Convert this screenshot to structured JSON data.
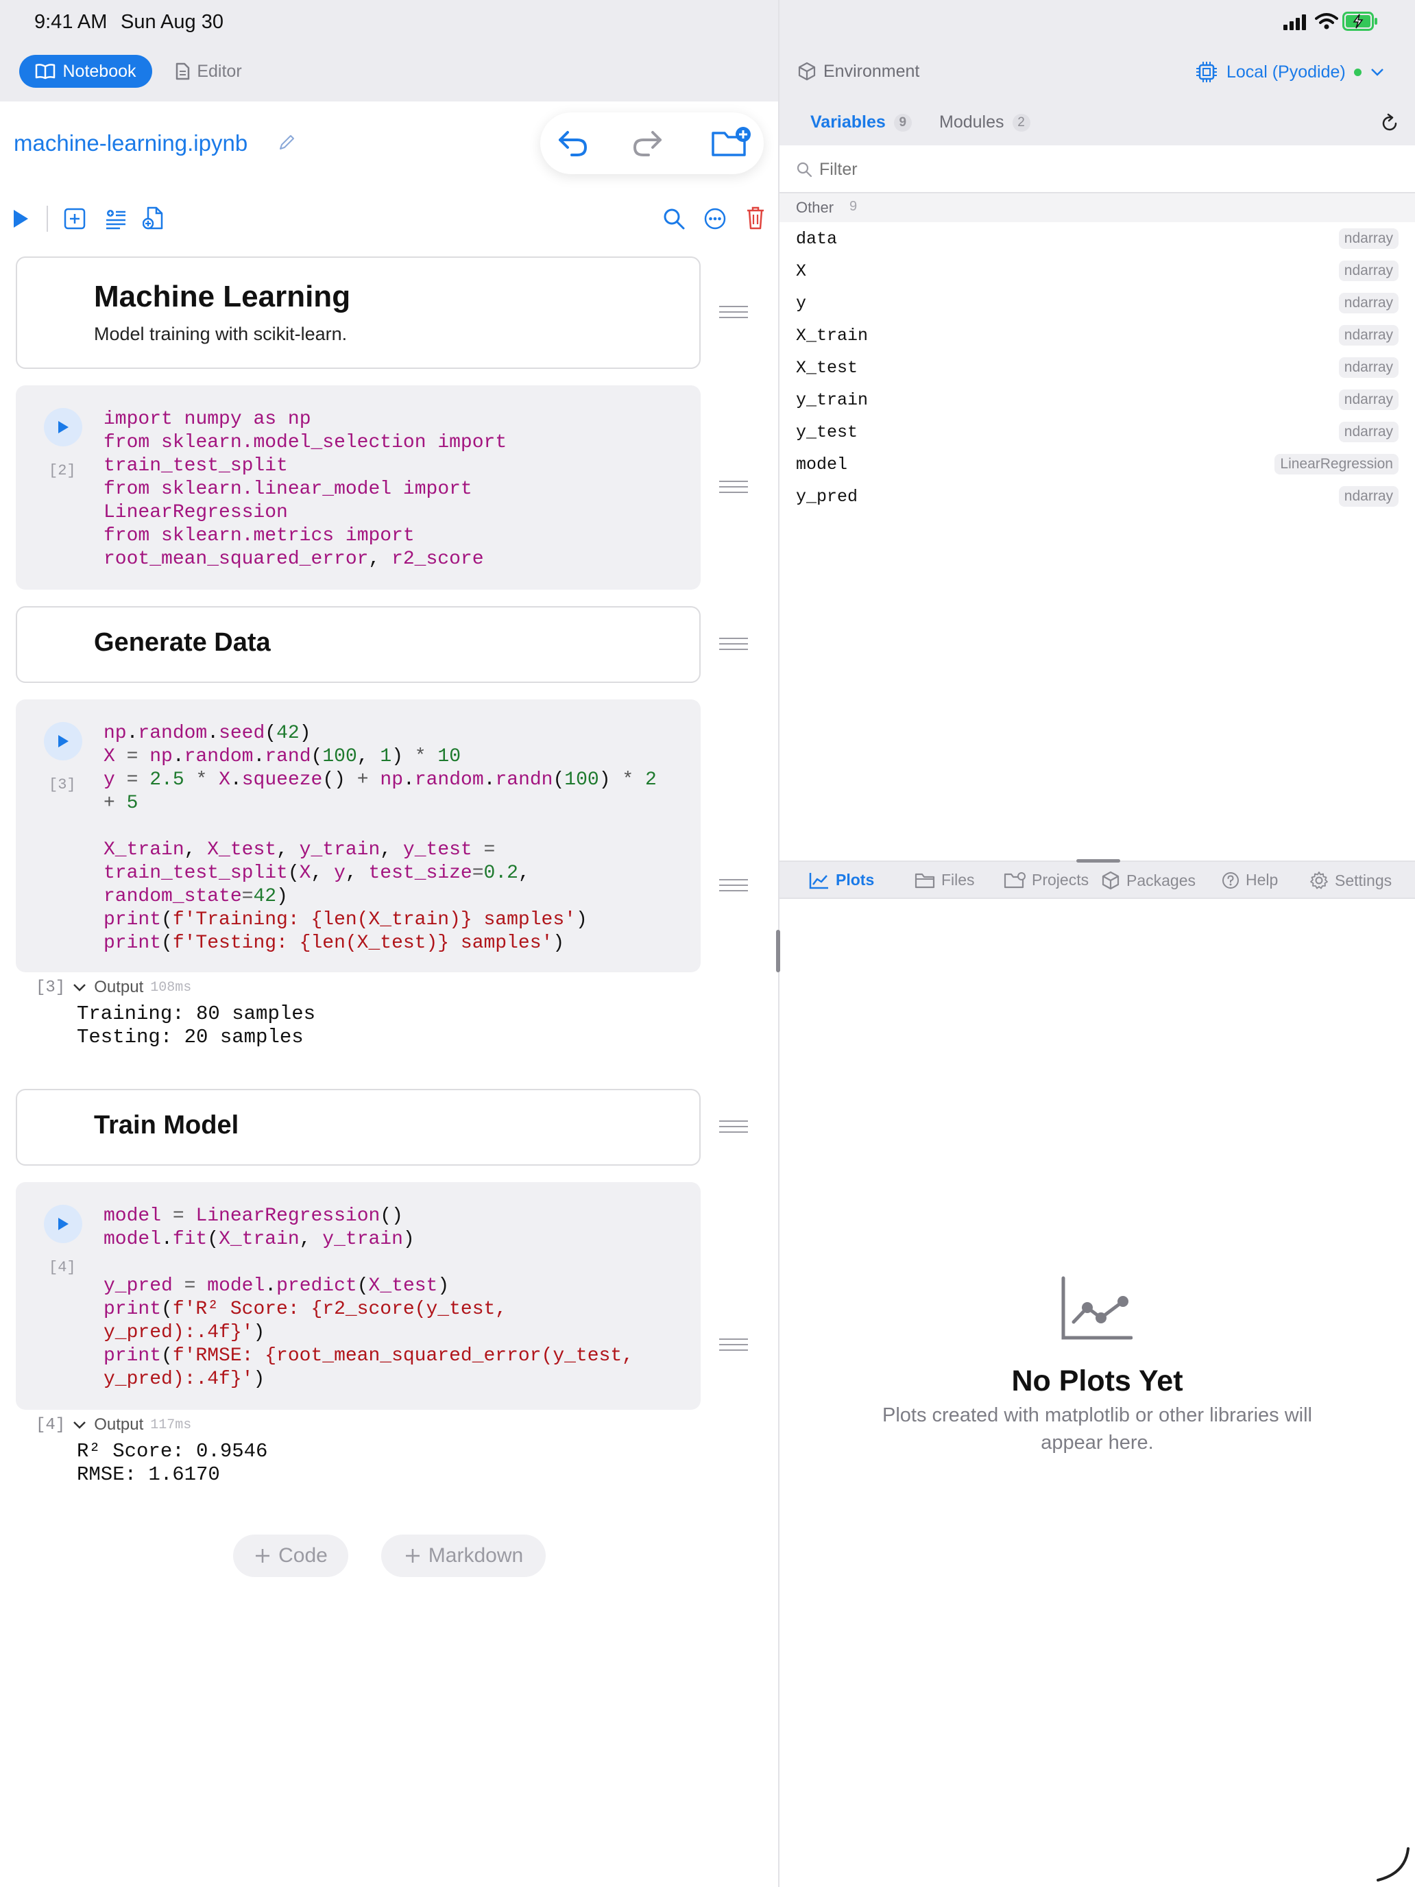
{
  "status_bar": {
    "time": "9:41 AM",
    "date": "Sun Aug 30"
  },
  "top_tabs": {
    "notebook": "Notebook",
    "editor": "Editor"
  },
  "notebook": {
    "filename": "machine-learning.ipynb",
    "cells": [
      {
        "type": "markdown",
        "title": "Machine Learning",
        "subtitle": "Model training with scikit-learn."
      },
      {
        "type": "code",
        "exec": "[2]"
      },
      {
        "type": "markdown",
        "title": "Generate Data"
      },
      {
        "type": "code",
        "exec": "[3]",
        "output_label": "Output",
        "output_time": "108ms",
        "output_exec": "[3]",
        "output_lines": [
          "Training: 80 samples",
          "Testing: 20 samples"
        ]
      },
      {
        "type": "markdown",
        "title": "Train Model"
      },
      {
        "type": "code",
        "exec": "[4]",
        "output_label": "Output",
        "output_time": "117ms",
        "output_exec": "[4]",
        "output_lines": [
          "R² Score: 0.9546",
          "RMSE: 1.6170"
        ]
      }
    ],
    "add_code": "Code",
    "add_markdown": "Markdown"
  },
  "environment": {
    "title": "Environment",
    "runtime": "Local (Pyodide)",
    "tabs": [
      {
        "label": "Variables",
        "count": "9"
      },
      {
        "label": "Modules",
        "count": "2"
      }
    ],
    "filter_placeholder": "Filter",
    "group": {
      "label": "Other",
      "count": "9"
    },
    "variables": [
      {
        "name": "data",
        "type": "ndarray"
      },
      {
        "name": "X",
        "type": "ndarray"
      },
      {
        "name": "y",
        "type": "ndarray"
      },
      {
        "name": "X_train",
        "type": "ndarray"
      },
      {
        "name": "X_test",
        "type": "ndarray"
      },
      {
        "name": "y_train",
        "type": "ndarray"
      },
      {
        "name": "y_test",
        "type": "ndarray"
      },
      {
        "name": "model",
        "type": "LinearRegression"
      },
      {
        "name": "y_pred",
        "type": "ndarray"
      }
    ]
  },
  "bottom_tabs": [
    "Plots",
    "Files",
    "Projects",
    "Packages",
    "Help",
    "Settings"
  ],
  "plots_empty": {
    "title": "No Plots Yet",
    "line1": "Plots created with matplotlib or other libraries will",
    "line2": "appear here."
  },
  "colors": {
    "accent": "#1a7ae8",
    "status_green": "#34c759",
    "delete_red": "#e0443e"
  }
}
